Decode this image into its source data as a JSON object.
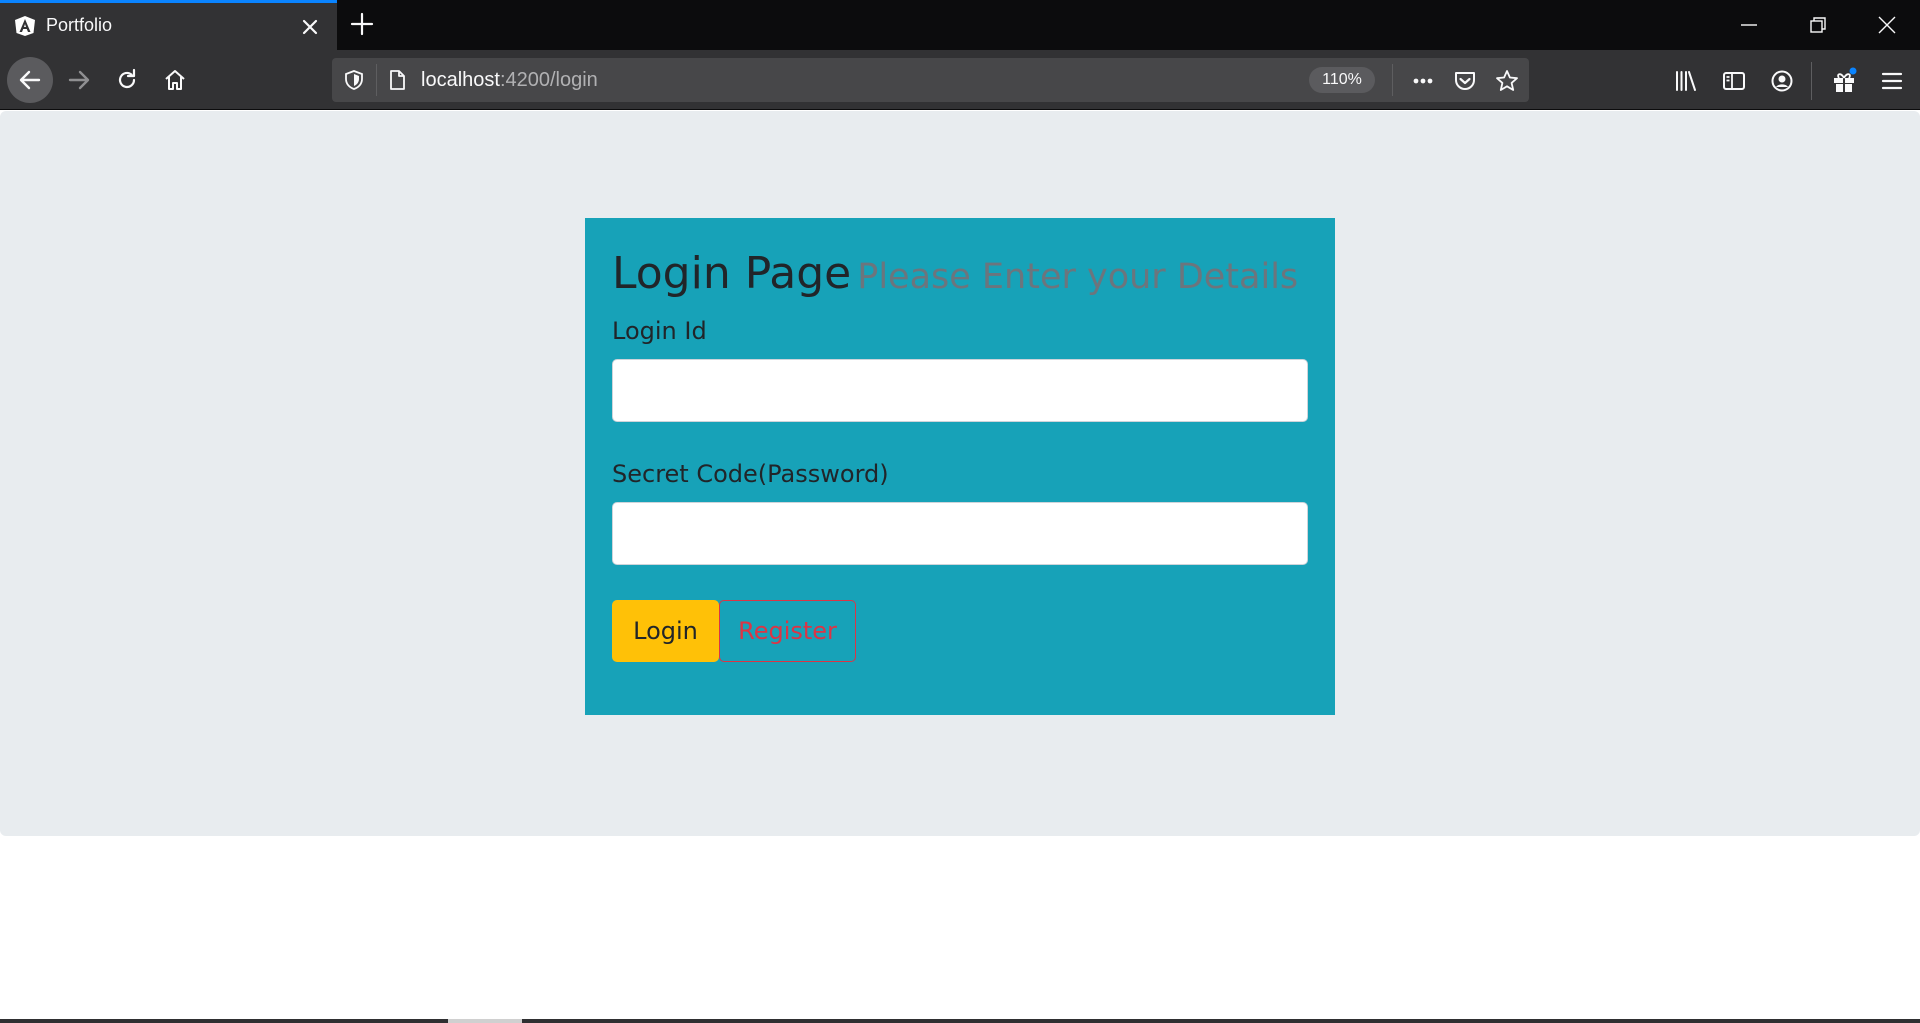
{
  "browser": {
    "tab": {
      "title": "Portfolio",
      "favicon": "angular-logo-icon"
    },
    "url": {
      "host": "localhost",
      "rest": ":4200/login"
    },
    "zoom": "110%",
    "colors": {
      "tab_accent": "#0a84ff",
      "chrome_bg": "#323234",
      "tabbar_bg": "#0c0c0d",
      "urlbar_bg": "#474749"
    },
    "icons": {
      "nav": [
        "back-arrow-icon",
        "forward-arrow-icon",
        "reload-icon",
        "home-icon"
      ],
      "url_actions": [
        "page-actions-menu-icon",
        "pocket-icon",
        "bookmark-star-icon"
      ],
      "toolbar": [
        "library-icon",
        "sidebar-icon",
        "account-icon",
        "whats-new-gift-icon",
        "hamburger-menu-icon"
      ],
      "window": [
        "minimize-icon",
        "restore-icon",
        "close-window-icon"
      ]
    }
  },
  "login": {
    "title": "Login Page",
    "subtitle": "Please Enter your Details",
    "login_id_label": "Login Id",
    "login_id_value": "",
    "password_label": "Secret Code(Password)",
    "password_value": "",
    "login_button": "Login",
    "register_button": "Register",
    "colors": {
      "card": "#17a2b8",
      "page_bg": "#e8ecef",
      "login_btn": "#ffc107",
      "register_btn": "#dc3545"
    }
  }
}
